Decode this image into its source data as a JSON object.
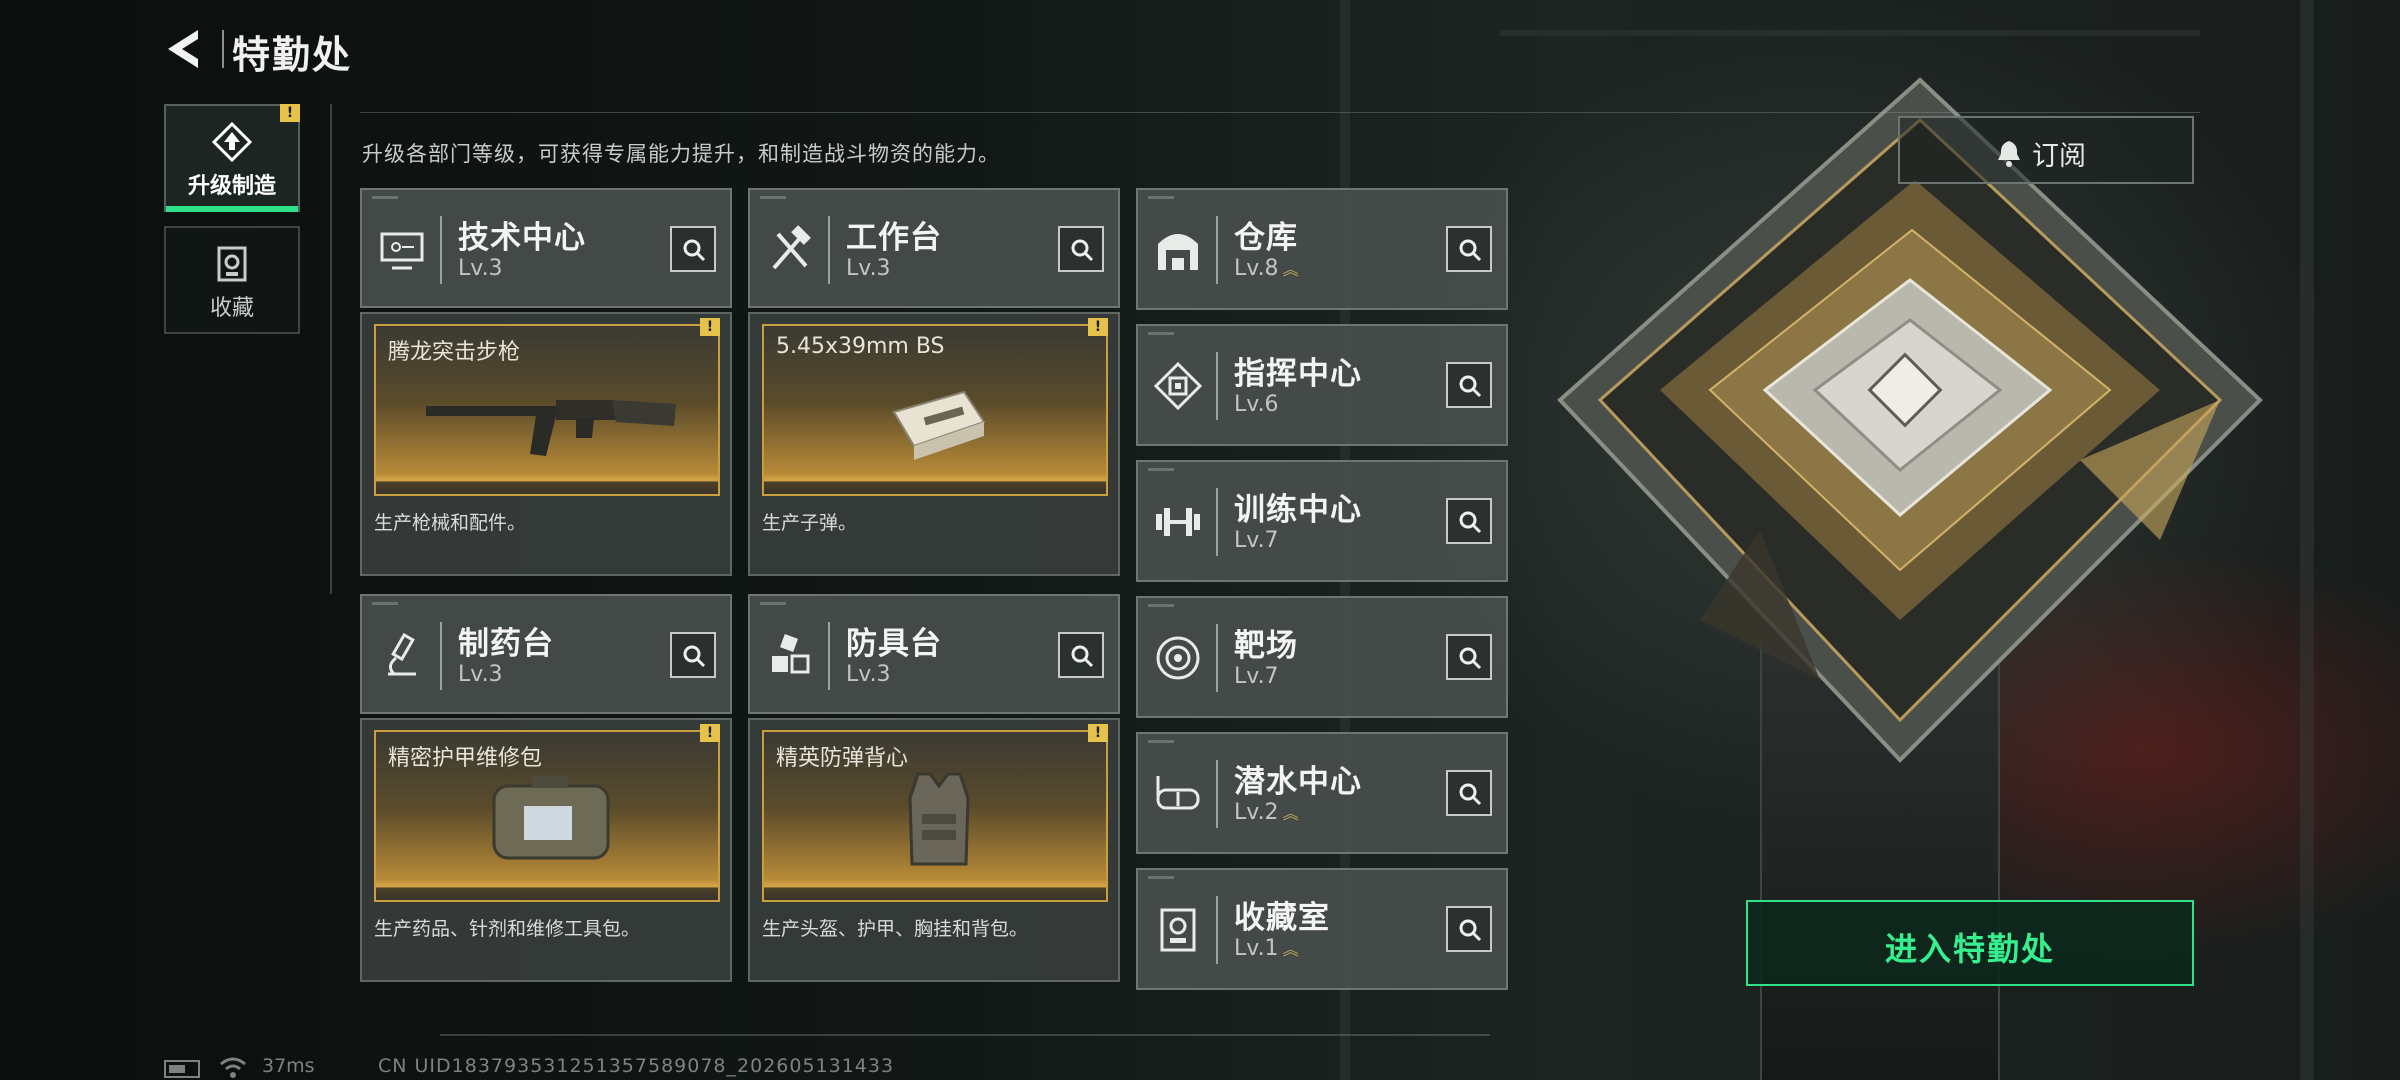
{
  "header": {
    "title": "特勤处"
  },
  "nav": {
    "tabs": [
      {
        "label": "升级制造",
        "active": true,
        "badge": "!"
      },
      {
        "label": "收藏",
        "active": false
      }
    ]
  },
  "intro_text": "升级各部门等级，可获得专属能力提升，和制造战斗物资的能力。",
  "departments": [
    {
      "name": "技术中心",
      "level": "Lv.3",
      "icon": "computer-icon"
    },
    {
      "name": "工作台",
      "level": "Lv.3",
      "icon": "hammer-wrench-icon"
    },
    {
      "name": "仓库",
      "level": "Lv.8",
      "icon": "warehouse-icon",
      "upgradable": true
    },
    {
      "name": "指挥中心",
      "level": "Lv.6",
      "icon": "chip-icon"
    },
    {
      "name": "训练中心",
      "level": "Lv.7",
      "icon": "dumbbell-icon"
    },
    {
      "name": "制药台",
      "level": "Lv.3",
      "icon": "microscope-icon"
    },
    {
      "name": "防具台",
      "level": "Lv.3",
      "icon": "cubes-icon"
    },
    {
      "name": "靶场",
      "level": "Lv.7",
      "icon": "target-icon"
    },
    {
      "name": "潜水中心",
      "level": "Lv.2",
      "icon": "diving-mask-icon",
      "upgradable": true
    },
    {
      "name": "收藏室",
      "level": "Lv.1",
      "icon": "trophy-icon",
      "upgradable": true
    }
  ],
  "productions": [
    {
      "item": "腾龙突击步枪",
      "desc": "生产枪械和配件。",
      "badge": "!"
    },
    {
      "item": "5.45x39mm BS",
      "desc": "生产子弹。",
      "badge": "!"
    },
    {
      "item": "精密护甲维修包",
      "desc": "生产药品、针剂和维修工具包。",
      "badge": "!"
    },
    {
      "item": "精英防弹背心",
      "desc": "生产头盔、护甲、胸挂和背包。",
      "badge": "!"
    }
  ],
  "subscribe_label": "订阅",
  "enter_label": "进入特勤处",
  "footer": {
    "ping": "37ms",
    "uid": "CN UID1837935312513575890​78_202605131433"
  },
  "colors": {
    "accent_green": "#2fe28a",
    "gold": "#c89e3e",
    "badge_yellow": "#e6c24a"
  }
}
